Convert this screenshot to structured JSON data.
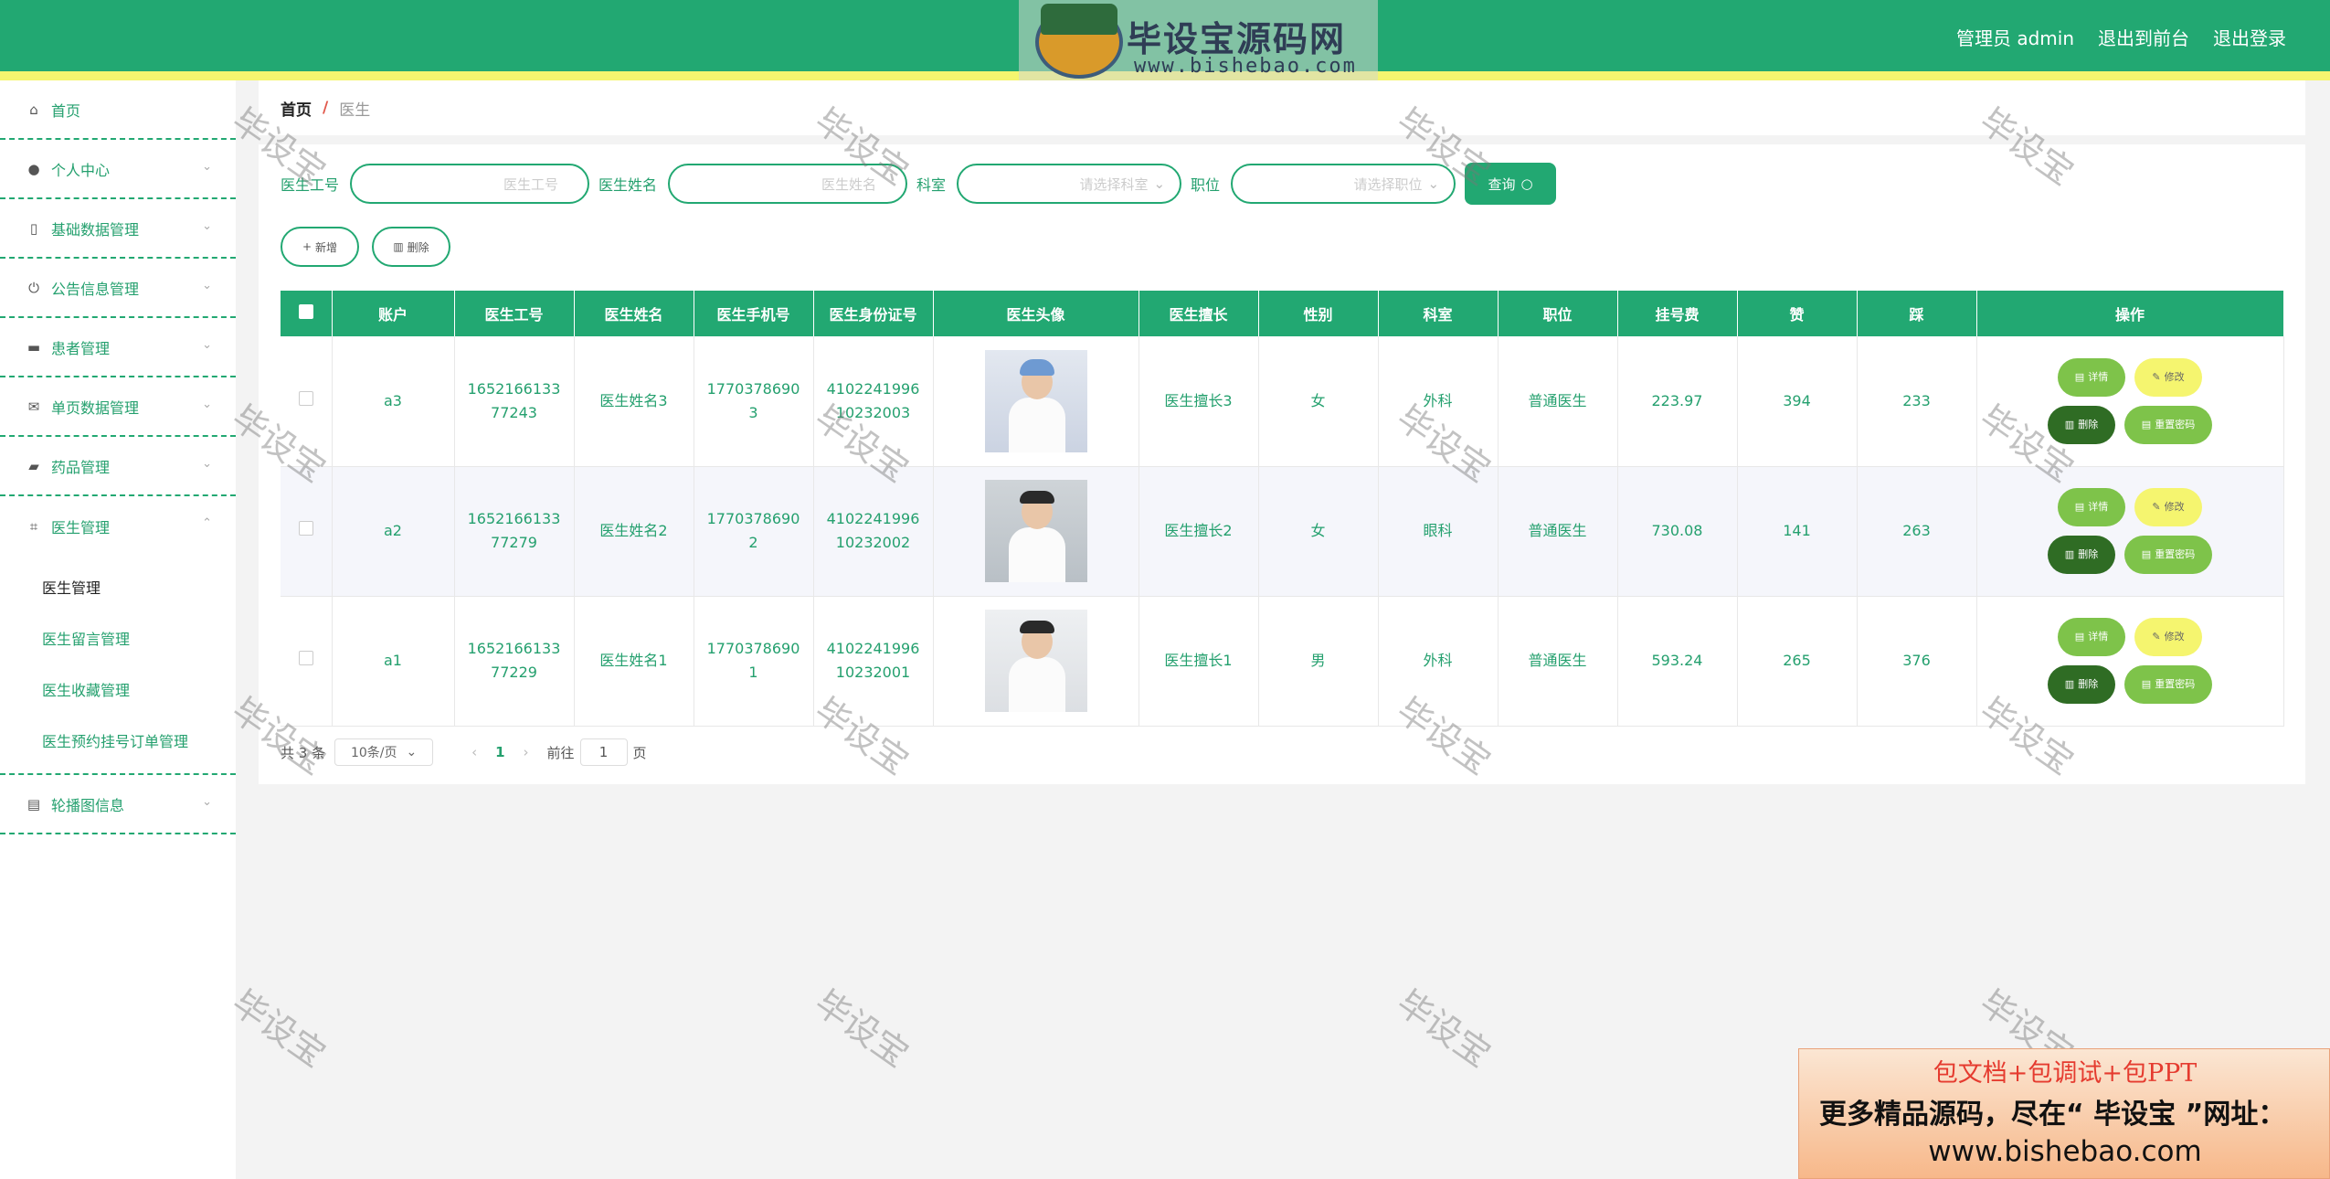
{
  "header": {
    "admin_label": "管理员 admin",
    "frontend_link": "退出到前台",
    "logout_link": "退出登录",
    "logo_title": "毕设宝源码网",
    "logo_url": "www.bishebao.com"
  },
  "sidebar": {
    "home": "首页",
    "personal": "个人中心",
    "base_data": "基础数据管理",
    "notice": "公告信息管理",
    "patient": "患者管理",
    "single_page": "单页数据管理",
    "medicine": "药品管理",
    "doctor": "医生管理",
    "doctor_sub": [
      "医生管理",
      "医生留言管理",
      "医生收藏管理",
      "医生预约挂号订单管理"
    ],
    "carousel": "轮播图信息"
  },
  "breadcrumb": {
    "home": "首页",
    "sep": "/",
    "current": "医生"
  },
  "filters": {
    "gonghao_label": "医生工号",
    "gonghao_placeholder": "医生工号",
    "name_label": "医生姓名",
    "name_placeholder": "医生姓名",
    "dept_label": "科室",
    "dept_placeholder": "请选择科室",
    "title_label": "职位",
    "title_placeholder": "请选择职位",
    "query_button": "查询"
  },
  "actions": {
    "add": "新增",
    "delete": "删除"
  },
  "table": {
    "headers": [
      "账户",
      "医生工号",
      "医生姓名",
      "医生手机号",
      "医生身份证号",
      "医生头像",
      "医生擅长",
      "性别",
      "科室",
      "职位",
      "挂号费",
      "赞",
      "踩",
      "操作"
    ],
    "rows": [
      {
        "account": "a3",
        "gonghao": "165216613377243",
        "name": "医生姓名3",
        "phone": "17703786903",
        "idcard": "410224199610232003",
        "skill": "医生擅长3",
        "gender": "女",
        "dept": "外科",
        "title": "普通医生",
        "fee": "223.97",
        "up": "394",
        "down": "233"
      },
      {
        "account": "a2",
        "gonghao": "165216613377279",
        "name": "医生姓名2",
        "phone": "17703786902",
        "idcard": "410224199610232002",
        "skill": "医生擅长2",
        "gender": "女",
        "dept": "眼科",
        "title": "普通医生",
        "fee": "730.08",
        "up": "141",
        "down": "263"
      },
      {
        "account": "a1",
        "gonghao": "165216613377229",
        "name": "医生姓名1",
        "phone": "17703786901",
        "idcard": "410224199610232001",
        "skill": "医生擅长1",
        "gender": "男",
        "dept": "外科",
        "title": "普通医生",
        "fee": "593.24",
        "up": "265",
        "down": "376"
      }
    ],
    "op_detail": "详情",
    "op_edit": "修改",
    "op_delete": "删除",
    "op_reset": "重置密码"
  },
  "pager": {
    "total": "共 3 条",
    "page_size": "10条/页",
    "current_page": "1",
    "goto_prefix": "前往",
    "goto_value": "1",
    "goto_suffix": "页"
  },
  "watermark": "毕设宝",
  "ad": {
    "line1": "包文档+包调试+包PPT",
    "line2": "更多精品源码，尽在“ 毕设宝 ”网址：",
    "line3": "www.bishebao.com"
  },
  "colors": {
    "primary": "#22a872",
    "stripe": "#f5f56f",
    "detail": "#7ec34a",
    "delete": "#2f6c24"
  }
}
